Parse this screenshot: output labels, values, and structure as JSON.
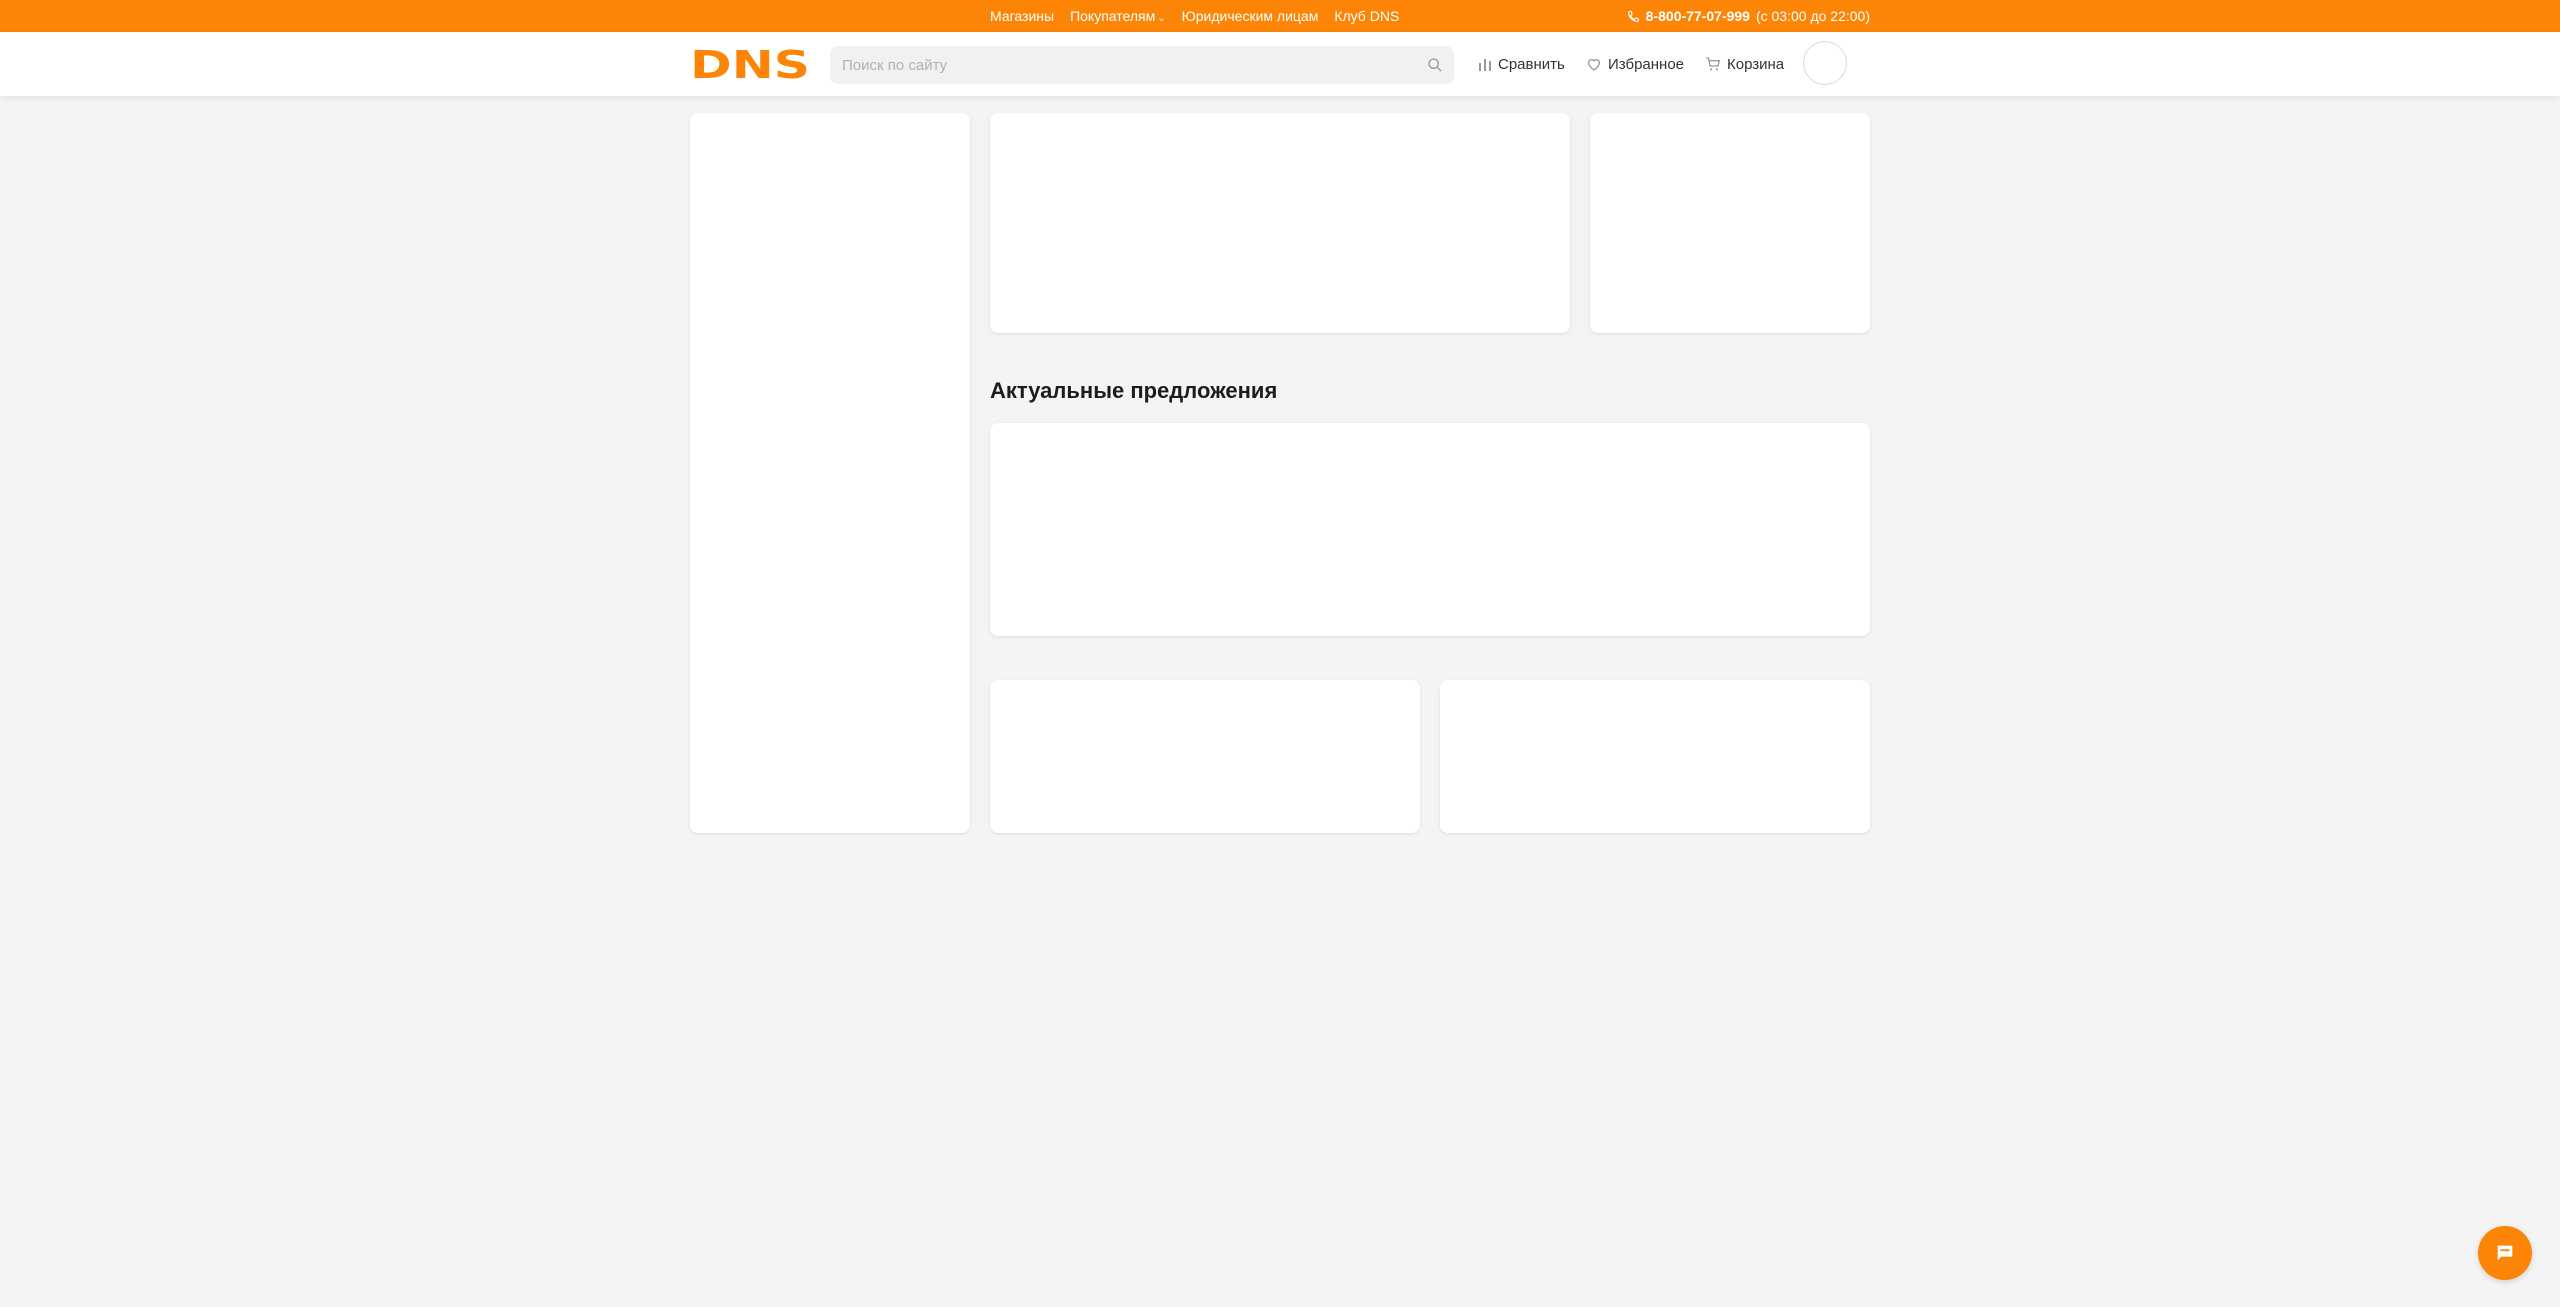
{
  "topbar": {
    "links": [
      "Магазины",
      "Покупателям",
      "Юридическим лицам",
      "Клуб DNS"
    ],
    "phone": "8-800-77-07-999",
    "hours": "(с 03:00 до 22:00)"
  },
  "header": {
    "logo_text": "DNS",
    "search_placeholder": "Поиск по сайту",
    "compare_label": "Сравнить",
    "favorites_label": "Избранное",
    "cart_label": "Корзина"
  },
  "main": {
    "offers_title": "Актуальные предложения"
  },
  "colors": {
    "brand_orange": "#fc8507",
    "background": "#f4f4f4"
  }
}
